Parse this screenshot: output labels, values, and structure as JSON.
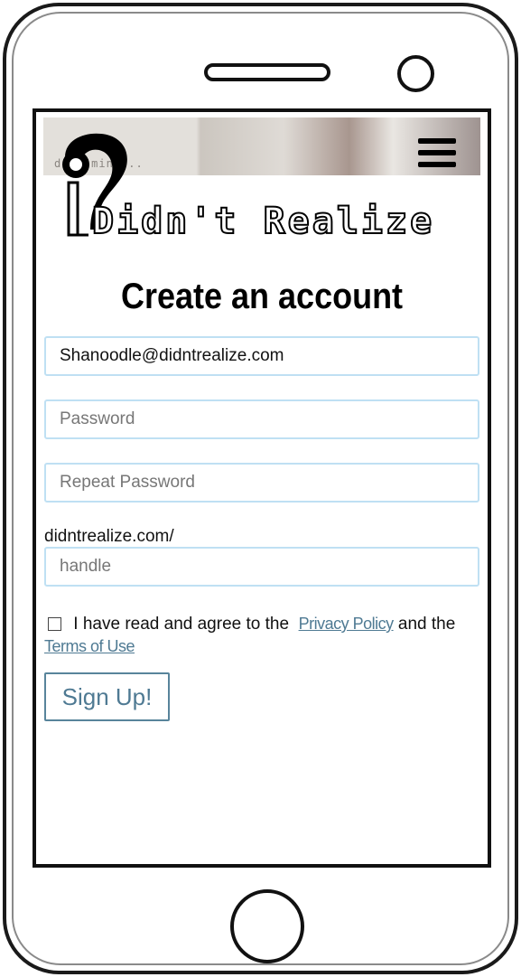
{
  "banner": {
    "tagline": "d   ur mind..."
  },
  "logo": {
    "text": "Didn't Realize"
  },
  "page": {
    "title": "Create an account"
  },
  "form": {
    "email_value": "Shanoodle@didntrealize.com",
    "password_placeholder": "Password",
    "repeat_password_placeholder": "Repeat Password",
    "url_prefix": "didntrealize.com/",
    "handle_placeholder": "handle",
    "terms_text_1": "I have read and agree to the",
    "privacy_link": "Privacy Policy",
    "terms_text_2": "and the",
    "terms_link": "Terms of Use",
    "signup_label": "Sign Up!",
    "agree_checked": false
  },
  "icons": {
    "menu": "hamburger-menu-icon",
    "logo": "question-mark-logo-icon",
    "checkbox": "checkbox-unchecked-icon"
  },
  "colors": {
    "input_border": "#bfe0f3",
    "link": "#4f7a93",
    "button_border": "#58849b",
    "button_text": "#4f7a93"
  }
}
